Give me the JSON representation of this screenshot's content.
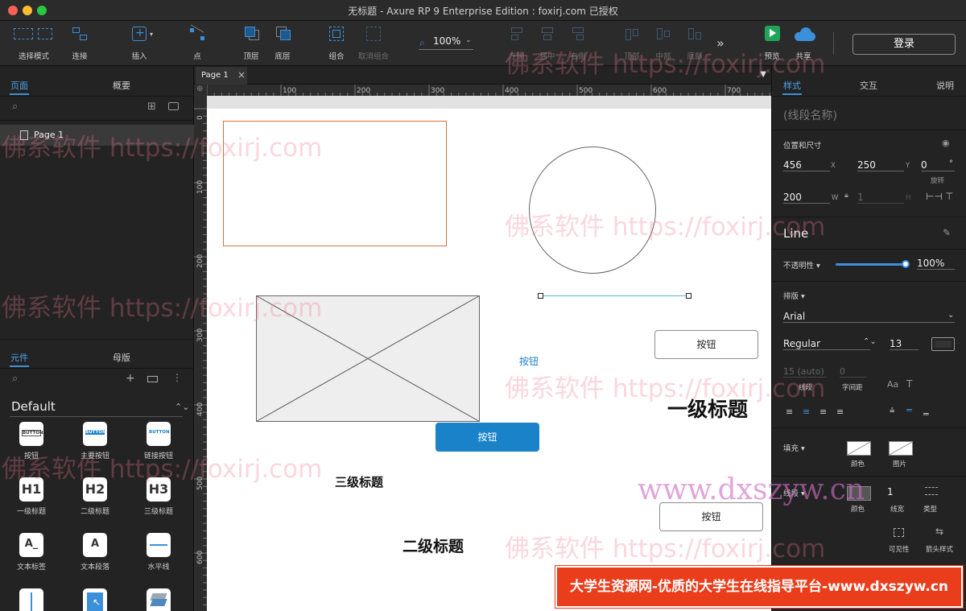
{
  "window": {
    "title": "无标题 - Axure RP 9 Enterprise Edition : foxirj.com 已授权",
    "lights": [
      "#fe5f57",
      "#febc2e",
      "#28c840"
    ]
  },
  "toolbar": {
    "select_mode": "选择模式",
    "connect": "连接",
    "insert": "插入",
    "point": "点",
    "top_layer": "顶层",
    "bottom_layer": "底层",
    "group": "组合",
    "ungroup": "取消组合",
    "zoom": "100%",
    "align_left": "左侧",
    "align_center": "居中",
    "align_right": "右侧",
    "align_top": "顶部",
    "align_middle": "中部",
    "align_bottom": "底部",
    "preview": "预览",
    "share": "共享",
    "login": "登录",
    "more_icon": "»"
  },
  "left_panel": {
    "tab_pages": "页面",
    "tab_outline": "概要",
    "page_item": "Page 1",
    "tab_widgets": "元件",
    "tab_masters": "母版",
    "library": "Default",
    "widgets": [
      {
        "label": "按钮",
        "icon_text": "BUTTON"
      },
      {
        "label": "主要按钮",
        "icon_text": "BUTTON"
      },
      {
        "label": "链接按钮",
        "icon_text": "BUTTON"
      },
      {
        "label": "一级标题",
        "icon_text": "H1"
      },
      {
        "label": "二级标题",
        "icon_text": "H2"
      },
      {
        "label": "三级标题",
        "icon_text": "H3"
      },
      {
        "label": "文本标签",
        "icon_text": "A_"
      },
      {
        "label": "文本段落",
        "icon_text": "A"
      },
      {
        "label": "水平线",
        "icon_text": ""
      }
    ]
  },
  "editor": {
    "tab": "Page 1",
    "close": "×",
    "h_ticks": [
      "100",
      "200",
      "300",
      "400",
      "500",
      "600",
      "700"
    ],
    "v_ticks": [
      "0",
      "100",
      "200",
      "300",
      "400",
      "500",
      "600"
    ]
  },
  "canvas": {
    "button_secondary_1": "按钮",
    "button_link": "按钮",
    "button_primary": "按钮",
    "button_secondary_2": "按钮",
    "h1": "一级标题",
    "h2": "二级标题",
    "h3": "三级标题"
  },
  "right_panel": {
    "tab_style": "样式",
    "tab_interact": "交互",
    "tab_notes": "说明",
    "name_placeholder": "(线段名称)",
    "pos_size": "位置和尺寸",
    "x": "456",
    "x_label": "X",
    "y": "250",
    "y_label": "Y",
    "rotation": "0",
    "rotation_unit": "°",
    "rotation_label": "旋转",
    "w": "200",
    "w_label": "W",
    "h": "1",
    "h_label": "H",
    "widget_type": "Line",
    "opacity_label": "不透明性 ▾",
    "opacity": "100%",
    "opacity_level": 1.0,
    "typography": "排版 ▾",
    "font": "Arial",
    "font_weight": "Regular",
    "font_size": "13",
    "line_spacing": "15 (auto)",
    "char_spacing": "0",
    "line_spacing_label": "线段",
    "char_spacing_label": "字间距",
    "fill": "填充 ▾",
    "fill_color": "颜色",
    "fill_image": "图片",
    "border": "线段 ▾",
    "border_color": "颜色",
    "border_width": "1",
    "border_width_label": "线宽",
    "border_type": "类型",
    "visibility": "可见性",
    "arrow_style": "箭头样式"
  },
  "watermarks": {
    "text": "佛系软件 https://foxirj.com",
    "site": "www.dxszyw.cn",
    "banner": "大学生资源网-优质的大学生在线指导平台-www.dxszyw.cn"
  },
  "colors": {
    "accent": "#3c8fd9",
    "primary_button": "#1a82c8",
    "selection_line": "#5bb8d8",
    "orange_border": "#d8703a"
  }
}
